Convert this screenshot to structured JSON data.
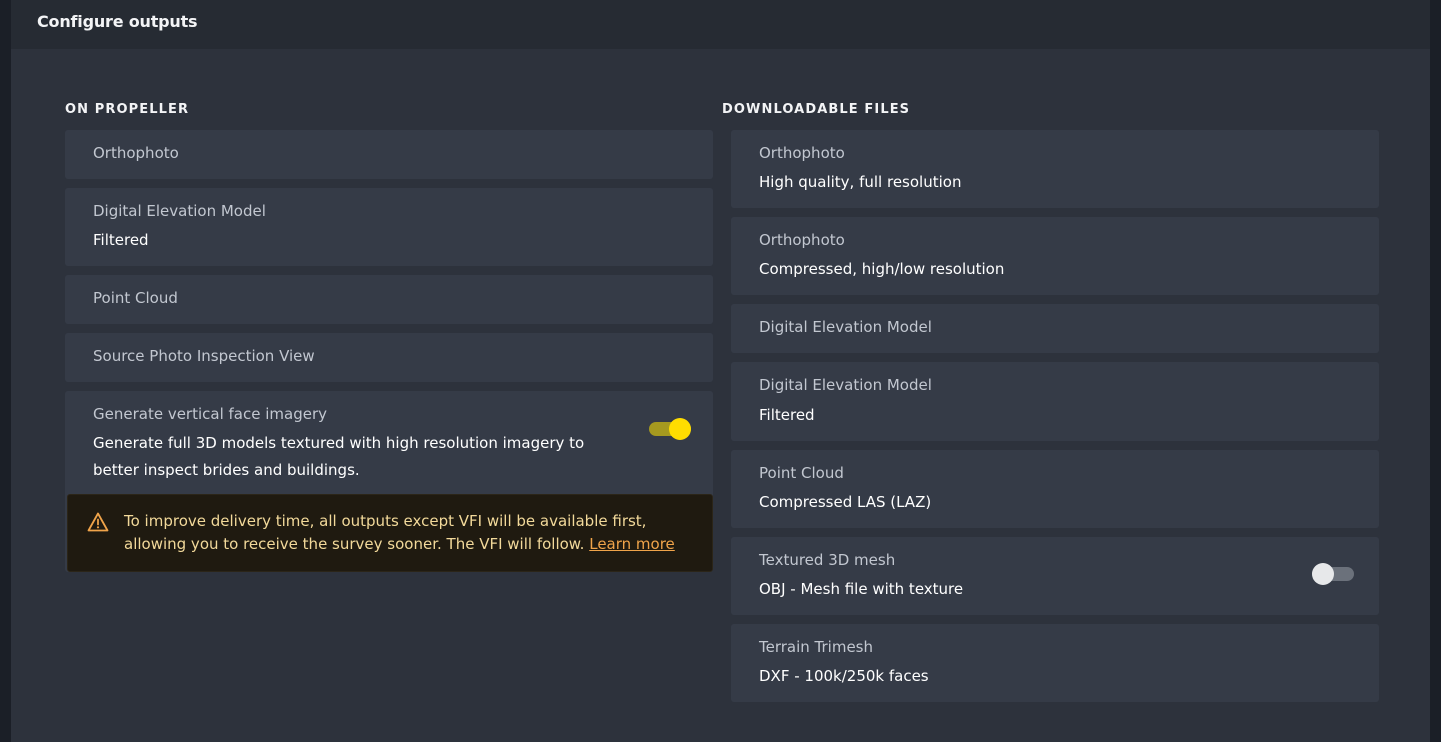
{
  "header": {
    "title": "Configure outputs"
  },
  "propeller": {
    "heading": "ON PROPELLER",
    "items": [
      {
        "title": "Orthophoto"
      },
      {
        "title": "Digital Elevation Model",
        "subtitle": "Filtered"
      },
      {
        "title": "Point Cloud"
      },
      {
        "title": "Source Photo Inspection View"
      },
      {
        "title": "Generate vertical face imagery",
        "subtitle_line1": "Generate full 3D models textured with high resolution imagery to",
        "subtitle_line2": "better inspect brides and buildings.",
        "toggle": "on"
      }
    ],
    "alert": {
      "text": "To improve delivery time, all outputs except VFI will be available first, allowing you to receive the survey sooner. The VFI will follow.",
      "link": "Learn more",
      "icon": "warning-icon"
    }
  },
  "downloads": {
    "heading": "DOWNLOADABLE FILES",
    "items": [
      {
        "title": "Orthophoto",
        "subtitle": "High quality, full resolution"
      },
      {
        "title": "Orthophoto",
        "subtitle": "Compressed, high/low resolution"
      },
      {
        "title": "Digital Elevation Model"
      },
      {
        "title": "Digital Elevation Model",
        "subtitle": "Filtered"
      },
      {
        "title": "Point Cloud",
        "subtitle": "Compressed LAS (LAZ)"
      },
      {
        "title": "Textured 3D mesh",
        "subtitle": "OBJ - Mesh file with texture",
        "toggle": "off"
      },
      {
        "title": "Terrain Trimesh",
        "subtitle": "DXF - 100k/250k faces"
      }
    ]
  },
  "colors": {
    "accent_yellow": "#ffdd00",
    "warning_text": "#f2d99a",
    "link": "#f0a44a"
  }
}
